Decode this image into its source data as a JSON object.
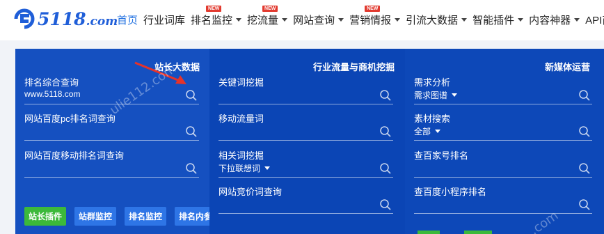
{
  "brand": {
    "logo_text": "5118",
    "logo_domain": ".com"
  },
  "nav": [
    {
      "label": "首页",
      "active": true,
      "caret": false,
      "new": false
    },
    {
      "label": "行业词库",
      "active": false,
      "caret": false,
      "new": false
    },
    {
      "label": "排名监控",
      "active": false,
      "caret": true,
      "new": true
    },
    {
      "label": "挖流量",
      "active": false,
      "caret": true,
      "new": true
    },
    {
      "label": "网站查询",
      "active": false,
      "caret": true,
      "new": false
    },
    {
      "label": "营销情报",
      "active": false,
      "caret": true,
      "new": true
    },
    {
      "label": "引流大数据",
      "active": false,
      "caret": true,
      "new": false
    },
    {
      "label": "智能插件",
      "active": false,
      "caret": true,
      "new": false
    },
    {
      "label": "内容神器",
      "active": false,
      "caret": true,
      "new": false
    },
    {
      "label": "API商城",
      "active": false,
      "caret": true,
      "new": false
    }
  ],
  "new_badge": "NEW",
  "columns": {
    "webmaster": {
      "title": "站长大数据",
      "fields": [
        {
          "label": "排名综合查询",
          "value": "www.5118.com",
          "dropdown": false
        },
        {
          "label": "网站百度pc排名词查询",
          "value": "",
          "dropdown": false
        },
        {
          "label": "网站百度移动排名词查询",
          "value": "",
          "dropdown": false
        }
      ],
      "buttons": [
        "站长插件",
        "站群监控",
        "排名监控",
        "排名内参"
      ]
    },
    "industry": {
      "title": "行业流量与商机挖掘",
      "fields": [
        {
          "label": "关键词挖掘",
          "value": "",
          "dropdown": false
        },
        {
          "label": "移动流量词",
          "value": "",
          "dropdown": false
        },
        {
          "label": "相关词挖掘",
          "value": "下拉联想词",
          "dropdown": true
        },
        {
          "label": "网站竞价词查询",
          "value": "",
          "dropdown": false
        }
      ]
    },
    "media": {
      "title": "新媒体运营",
      "fields": [
        {
          "label": "需求分析",
          "value": "需求图谱",
          "dropdown": true
        },
        {
          "label": "素材搜索",
          "value": "全部",
          "dropdown": true
        },
        {
          "label": "查百家号排名",
          "value": "",
          "dropdown": false
        },
        {
          "label": "查百度小程序排名",
          "value": "",
          "dropdown": false
        }
      ]
    }
  },
  "watermarks": [
    "ulie112.com",
    ".com"
  ],
  "colors": {
    "brand_blue": "#1f5ed8",
    "panel_blue": "#1550c0",
    "accent_green": "#3cb93a",
    "arrow_red": "#e5332a"
  }
}
